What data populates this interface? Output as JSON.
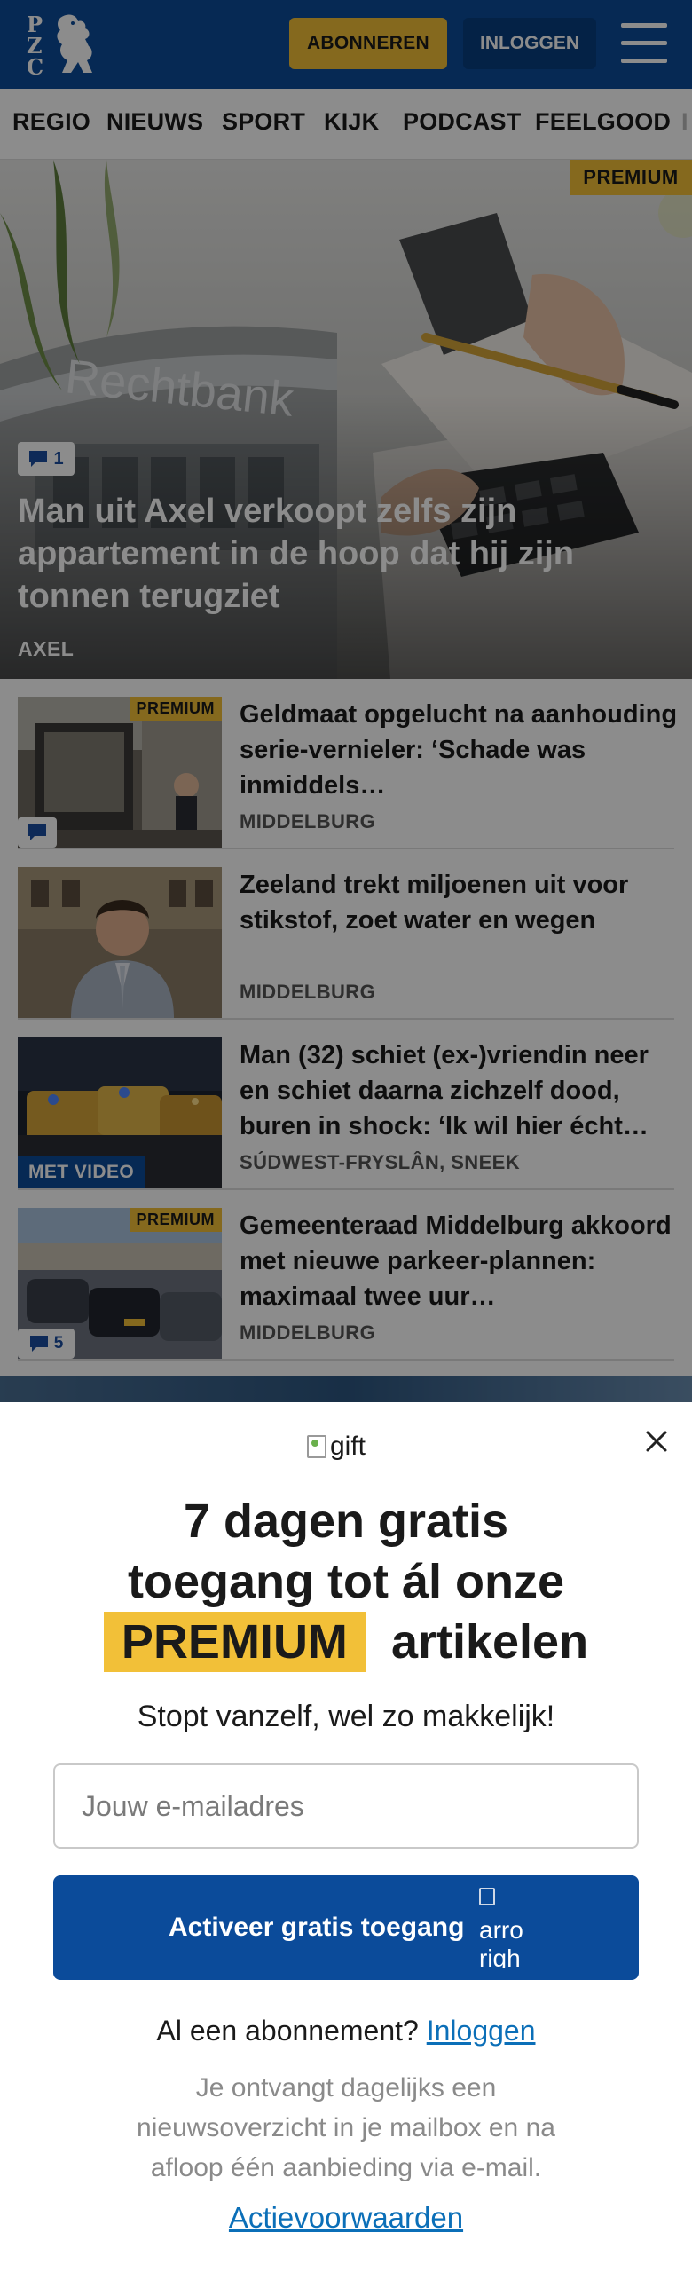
{
  "header": {
    "logo_text": "PZC",
    "subscribe_label": "ABONNEREN",
    "login_label": "INLOGGEN",
    "menu_icon": "hamburger-menu-icon",
    "brand_color": "#0b4b9a",
    "accent_color": "#f2c038"
  },
  "nav": {
    "items": [
      "REGIO",
      "NIEUWS",
      "SPORT",
      "KIJK",
      "PODCAST",
      "FEELGOOD",
      "I"
    ]
  },
  "hero": {
    "premium_label": "PREMIUM",
    "building_sign": "Rechtbank",
    "comment_count": "1",
    "title": "Man uit Axel verkoopt zelfs zijn appartement in de hoop dat hij zijn tonnen terugziet",
    "location": "AXEL"
  },
  "articles": [
    {
      "title": "Geldmaat opgelucht na aanhouding serie-vernieler: ‘Schade was inmiddels…",
      "location": "MIDDELBURG",
      "premium_label": "PREMIUM",
      "comment_count": "",
      "video_label": ""
    },
    {
      "title": "Zeeland trekt miljoenen uit voor stikstof, zoet water en wegen",
      "location": "MIDDELBURG",
      "premium_label": "",
      "comment_count": "",
      "video_label": ""
    },
    {
      "title": "Man (32) schiet (ex-)vriendin neer en schiet daarna zichzelf dood, buren in shock: ‘Ik wil hier écht…",
      "location": "SÚDWEST-FRYSLÂN, SNEEK",
      "premium_label": "",
      "comment_count": "",
      "video_label": "MET VIDEO"
    },
    {
      "title": "Gemeenteraad Middelburg akkoord met nieuwe parkeer-plannen: maximaal twee uur…",
      "location": "MIDDELBURG",
      "premium_label": "PREMIUM",
      "comment_count": "5",
      "video_label": ""
    }
  ],
  "modal": {
    "gift_alt": "gift",
    "headline_line1": "7 dagen gratis",
    "headline_line2": "toegang tot ál onze",
    "headline_premium": "PREMIUM",
    "headline_line3_rest": "artikelen",
    "subtitle": "Stopt vanzelf, wel zo makkelijk!",
    "email_placeholder": "Jouw e-mailadres",
    "cta_label": "Activeer gratis toegang",
    "cta_icon_alt_line1": "arro",
    "cta_icon_alt_line2": "righ",
    "already_text": "Al een abonnement?",
    "already_link": "Inloggen",
    "disclaimer": "Je ontvangt dagelijks een nieuwsoverzicht in je mailbox en na afloop één aanbieding via e-mail.",
    "terms_link": "Actievoorwaarden",
    "close_icon": "close-icon"
  }
}
